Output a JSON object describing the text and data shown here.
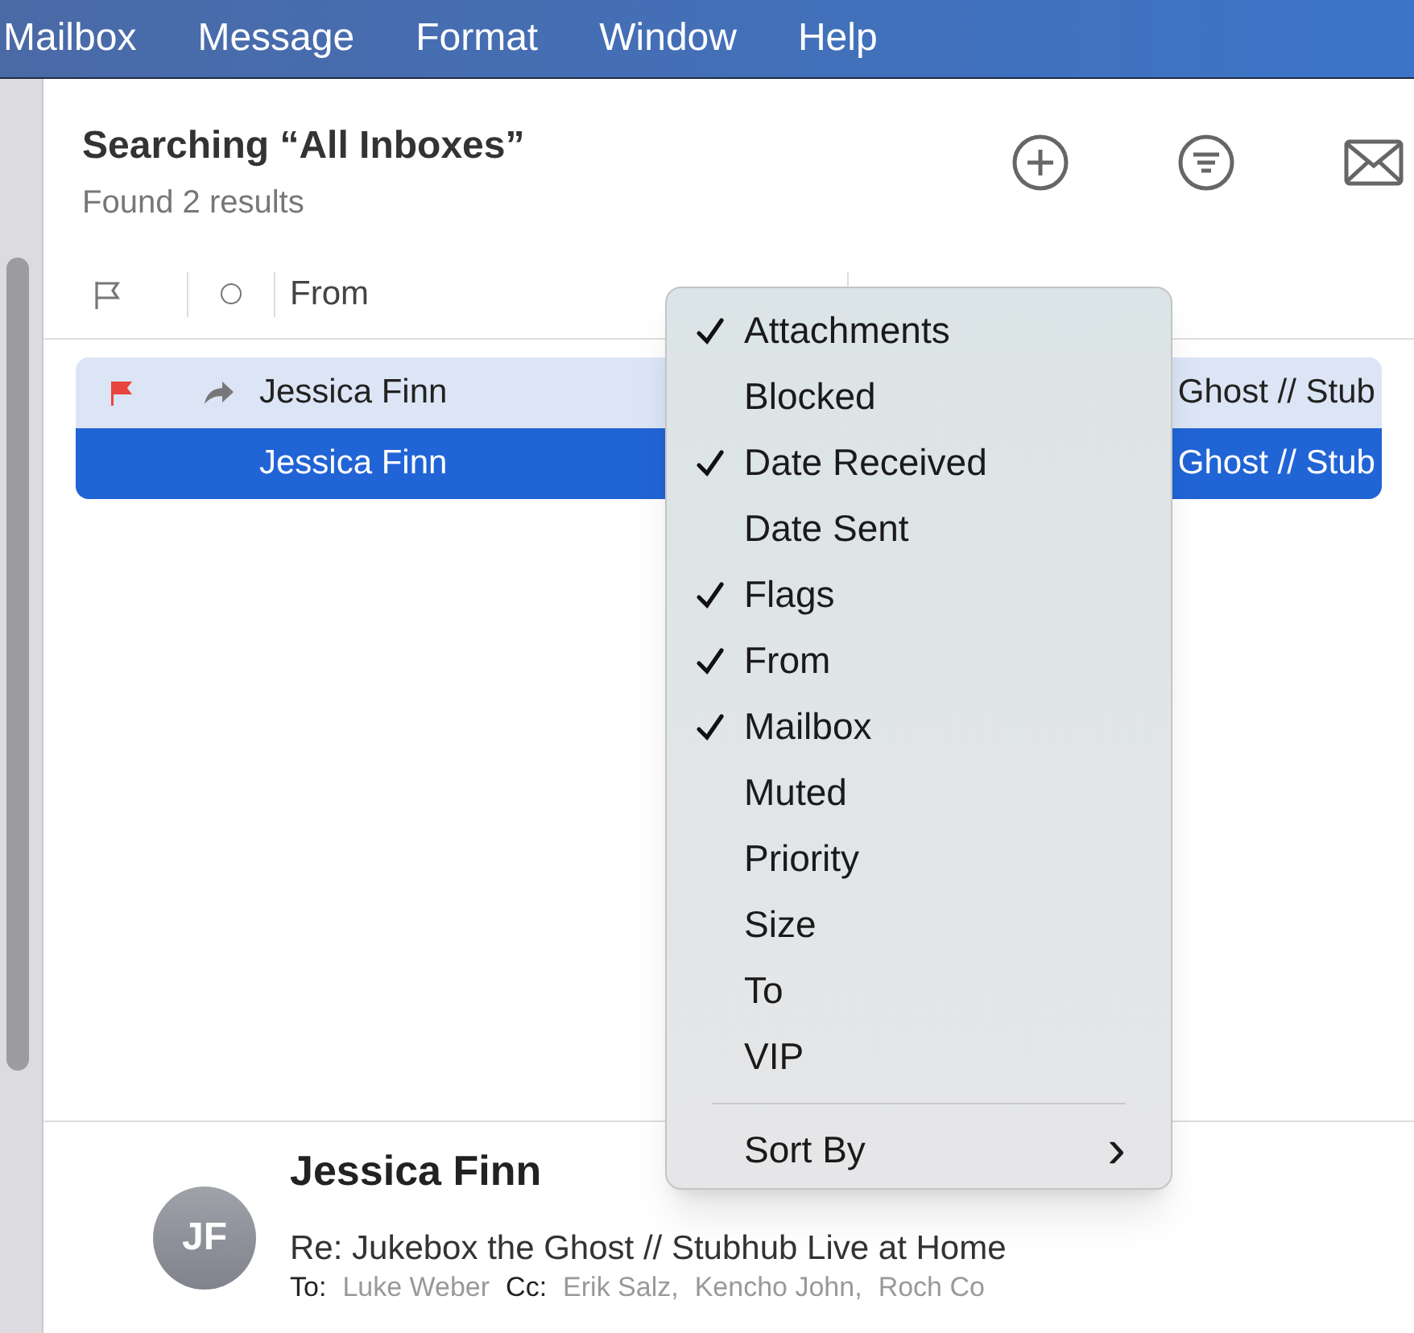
{
  "menu_bar": [
    "Mailbox",
    "Message",
    "Format",
    "Window",
    "Help"
  ],
  "search": {
    "title": "Searching “All Inboxes”",
    "subtitle": "Found 2 results"
  },
  "columns": [
    {
      "kind": "flag"
    },
    {
      "kind": "status"
    },
    {
      "kind": "text",
      "label": "From"
    }
  ],
  "messages": [
    {
      "flagged": true,
      "replied": true,
      "from": "Jessica Finn",
      "subject": "Ghost // Stub",
      "selected": false
    },
    {
      "flagged": false,
      "replied": false,
      "from": "Jessica Finn",
      "subject": "Ghost // Stub",
      "selected": true
    }
  ],
  "context_menu": {
    "items": [
      {
        "label": "Attachments",
        "checked": true
      },
      {
        "label": "Blocked",
        "checked": false
      },
      {
        "label": "Date Received",
        "checked": true
      },
      {
        "label": "Date Sent",
        "checked": false
      },
      {
        "label": "Flags",
        "checked": true
      },
      {
        "label": "From",
        "checked": true
      },
      {
        "label": "Mailbox",
        "checked": true
      },
      {
        "label": "Muted",
        "checked": false
      },
      {
        "label": "Priority",
        "checked": false
      },
      {
        "label": "Size",
        "checked": false
      },
      {
        "label": "To",
        "checked": false
      },
      {
        "label": "VIP",
        "checked": false
      }
    ],
    "submenu": {
      "label": "Sort By",
      "glyph": "›"
    }
  },
  "preview": {
    "initials": "JF",
    "sender": "Jessica Finn",
    "subject": "Re: Jukebox the Ghost // Stubhub Live at Home",
    "recipients": [
      {
        "label": "To:",
        "names": [
          "Luke Weber"
        ]
      },
      {
        "label": "Cc:",
        "names": [
          "Erik Salz,",
          "Kencho John,",
          "Roch Co"
        ]
      }
    ]
  }
}
